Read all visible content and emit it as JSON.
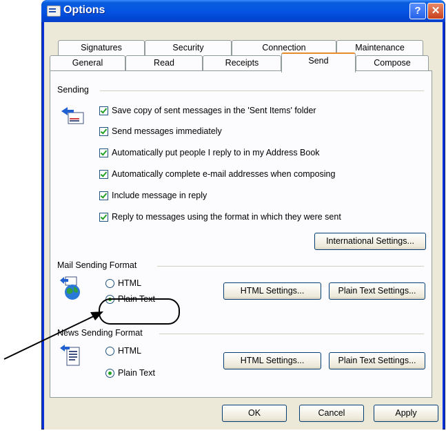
{
  "window": {
    "title": "Options",
    "help_glyph": "?",
    "close_glyph": "✕"
  },
  "tabs": {
    "row1": [
      "Signatures",
      "Security",
      "Connection",
      "Maintenance"
    ],
    "row2": [
      "General",
      "Read",
      "Receipts",
      "Send",
      "Compose"
    ],
    "active": "Send"
  },
  "sending": {
    "label": "Sending",
    "options": [
      {
        "label": "Save copy of sent messages in the 'Sent Items' folder",
        "checked": true
      },
      {
        "label": "Send messages immediately",
        "checked": true
      },
      {
        "label": "Automatically put people I reply to in my Address Book",
        "checked": true
      },
      {
        "label": "Automatically complete e-mail addresses when composing",
        "checked": true
      },
      {
        "label": "Include message in reply",
        "checked": true
      },
      {
        "label": "Reply to messages using the format in which they were sent",
        "checked": true
      }
    ],
    "intl_button": "International Settings..."
  },
  "mail_format": {
    "label": "Mail Sending Format",
    "html_label": "HTML",
    "plain_label": "Plain Text",
    "selected": "Plain Text",
    "html_settings": "HTML Settings...",
    "plain_settings": "Plain Text Settings..."
  },
  "news_format": {
    "label": "News Sending Format",
    "html_label": "HTML",
    "plain_label": "Plain Text",
    "selected": "Plain Text",
    "html_settings": "HTML Settings...",
    "plain_settings": "Plain Text Settings..."
  },
  "footer": {
    "ok": "OK",
    "cancel": "Cancel",
    "apply": "Apply"
  }
}
